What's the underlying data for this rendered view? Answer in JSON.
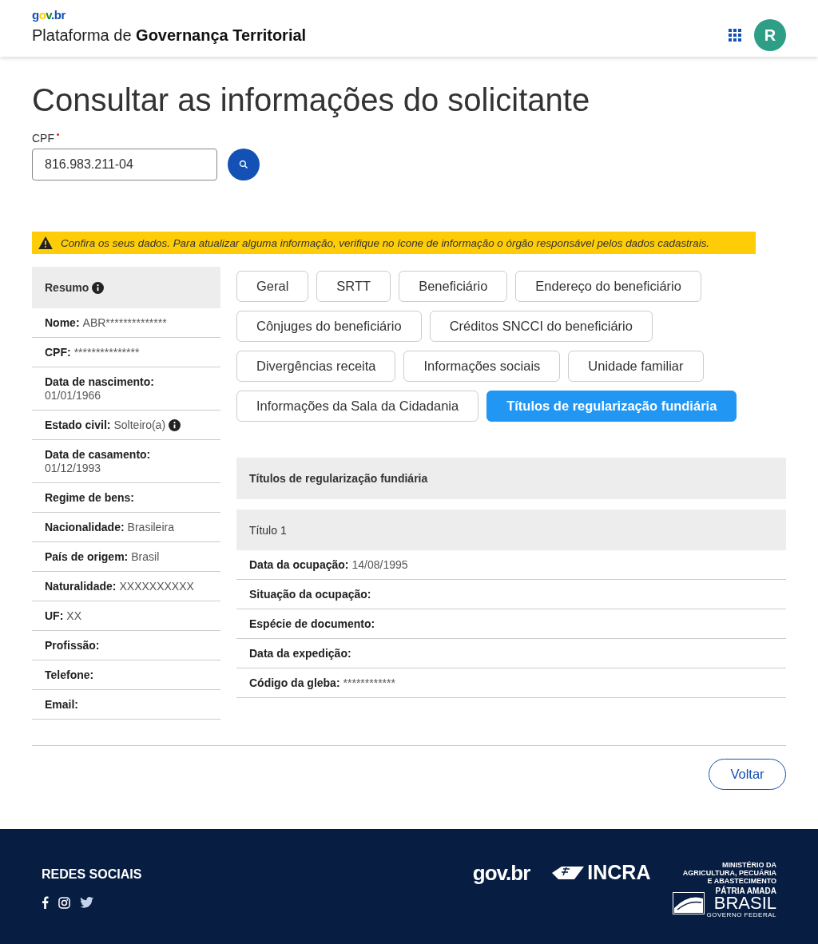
{
  "header": {
    "logo": "gov.br",
    "title_prefix": "Plataforma de ",
    "title_bold": "Governança Territorial",
    "avatar": "R"
  },
  "page_title": "Consultar as informações do solicitante",
  "cpf_field": {
    "label": "CPF",
    "required": true,
    "value": "816.983.211-04"
  },
  "warning": "Confira os seus dados. Para atualizar alguma informação, verifique no ícone de informação o órgão responsável pelos dados cadastrais.",
  "summary": {
    "title": "Resumo",
    "items": [
      {
        "label": "Nome:",
        "value": "ABR**************",
        "kind": "inline",
        "info": false
      },
      {
        "label": "CPF:",
        "value": "***************",
        "kind": "inline",
        "info": false
      },
      {
        "label": "Data de nascimento:",
        "value": "01/01/1966",
        "kind": "stacked",
        "info": false
      },
      {
        "label": "Estado civil:",
        "value": "Solteiro(a)",
        "kind": "inline",
        "info": true
      },
      {
        "label": "Data de casamento:",
        "value": "01/12/1993",
        "kind": "stacked",
        "info": false
      },
      {
        "label": "Regime de bens:",
        "kind": "inline",
        "info": false
      },
      {
        "label": "Nacionalidade:",
        "value": "Brasileira",
        "kind": "inline",
        "info": false
      },
      {
        "label": "País de origem:",
        "value": "Brasil",
        "kind": "inline",
        "info": false
      },
      {
        "label": "Naturalidade:",
        "value": "XXXXXXXXXX",
        "kind": "inline",
        "info": false
      },
      {
        "label": "UF:",
        "value": "XX",
        "kind": "inline",
        "info": false
      },
      {
        "label": "Profissão:",
        "kind": "inline",
        "info": false
      },
      {
        "label": "Telefone:",
        "kind": "inline",
        "info": false
      },
      {
        "label": "Email:",
        "kind": "inline",
        "info": false
      }
    ]
  },
  "tabs": [
    [
      {
        "label": "Geral",
        "selected": false
      },
      {
        "label": "SRTT",
        "selected": false
      },
      {
        "label": "Beneficiário",
        "selected": false
      },
      {
        "label": "Endereço do beneficiário",
        "selected": false
      }
    ],
    [
      {
        "label": "Cônjuges do beneficiário",
        "selected": false
      },
      {
        "label": "Créditos SNCCI do beneficiário",
        "selected": false
      }
    ],
    [
      {
        "label": "Divergências receita",
        "selected": false
      },
      {
        "label": "Informações sociais",
        "selected": false
      },
      {
        "label": "Unidade familiar",
        "selected": false
      }
    ],
    [
      {
        "label": "Informações da Sala da Cidadania",
        "selected": false
      },
      {
        "label": "Títulos de regularização fundiária",
        "selected": true
      }
    ]
  ],
  "section": {
    "title": "Títulos de regularização fundiária",
    "subtitle": "Título 1",
    "rows": [
      {
        "label": "Data da ocupação:",
        "value": "14/08/1995"
      },
      {
        "label": "Situação da ocupação:"
      },
      {
        "label": "Espécie de documento:"
      },
      {
        "label": "Data da expedição:"
      },
      {
        "label": "Código da gleba:",
        "value": "************"
      }
    ]
  },
  "back_button": "Voltar",
  "footer": {
    "social_title": "REDES SOCIAIS",
    "govbr": "gov.br",
    "incra": "INCRA",
    "ministry": [
      "MINISTÉRIO DA",
      "AGRICULTURA, PECUÁRIA",
      "E ABASTECIMENTO"
    ],
    "patria": "PÁTRIA AMADA",
    "brasil": "BRASIL",
    "governo": "GOVERNO FEDERAL"
  }
}
